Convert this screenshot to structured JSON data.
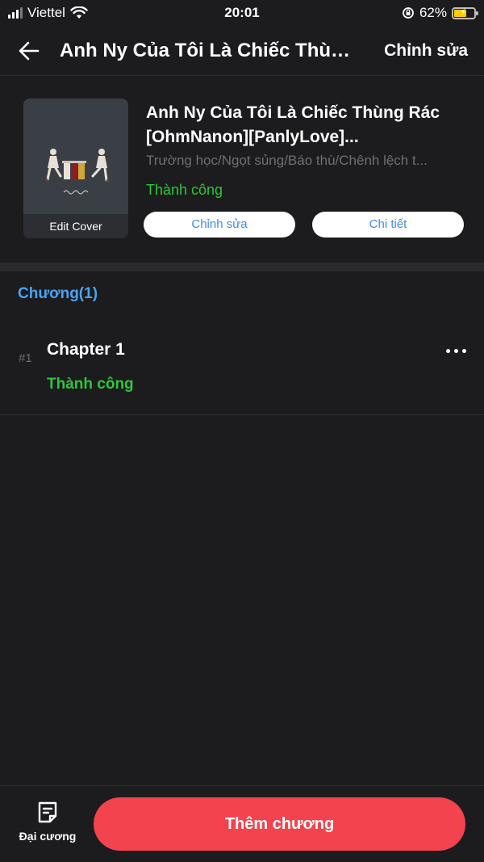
{
  "status_bar": {
    "carrier": "Viettel",
    "time": "20:01",
    "battery": "62%",
    "battery_level": 0.62
  },
  "header": {
    "title": "Anh Ny Của Tôi Là Chiếc Thùn...",
    "edit_label": "Chỉnh sửa"
  },
  "book": {
    "cover_label": "Edit Cover",
    "title_line1": "Anh Ny Của Tôi Là Chiếc Thùng Rác",
    "title_line2": "[OhmNanon][PanlyLove]...",
    "tags": "Trường học/Ngọt sủng/Báo thù/Chênh lệch t...",
    "status": "Thành công",
    "edit_button": "Chỉnh sửa",
    "detail_button": "Chi tiết"
  },
  "chapters": {
    "heading": "Chương(1)",
    "items": [
      {
        "number": "#1",
        "title": "Chapter 1",
        "status": "Thành công"
      }
    ]
  },
  "bottom_bar": {
    "outline_label": "Đại cương",
    "add_chapter_label": "Thêm chương"
  },
  "colors": {
    "background": "#1c1c1e",
    "accent_blue": "#4aa3f2",
    "success_green": "#2ec63a",
    "primary_red": "#f2434e"
  },
  "icons": [
    "signal-icon",
    "wifi-icon",
    "rotation-lock-icon",
    "battery-icon",
    "back-arrow-icon",
    "more-icon",
    "outline-icon"
  ]
}
